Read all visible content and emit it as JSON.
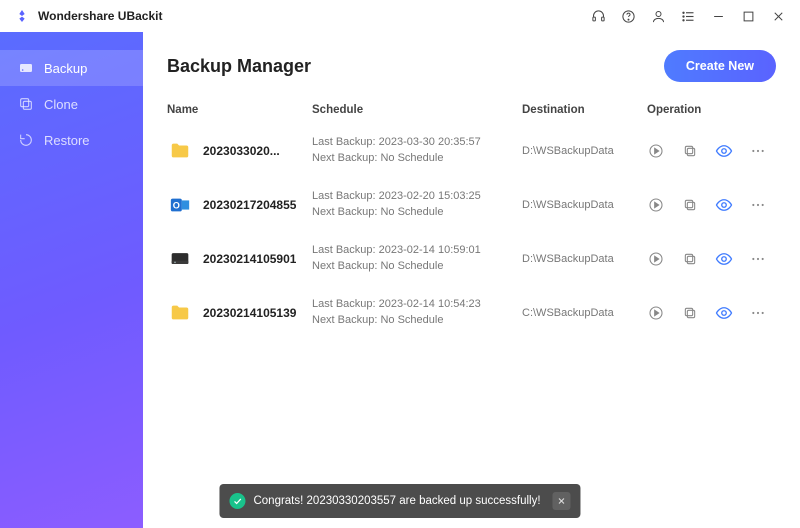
{
  "app_title": "Wondershare UBackit",
  "titlebar_icons": [
    "headset",
    "help",
    "user",
    "list",
    "minimize",
    "maximize",
    "close"
  ],
  "sidebar": {
    "items": [
      {
        "label": "Backup",
        "icon": "disk-icon",
        "active": true
      },
      {
        "label": "Clone",
        "icon": "copy-icon",
        "active": false
      },
      {
        "label": "Restore",
        "icon": "restore-icon",
        "active": false
      }
    ]
  },
  "header": {
    "title": "Backup Manager",
    "create_label": "Create New"
  },
  "columns": {
    "name": "Name",
    "schedule": "Schedule",
    "destination": "Destination",
    "operation": "Operation"
  },
  "rows": [
    {
      "icon": "folder",
      "name": "2023033020...",
      "last": "Last Backup: 2023-03-30 20:35:57",
      "next": "Next Backup: No Schedule",
      "dest": "D:\\WSBackupData"
    },
    {
      "icon": "outlook",
      "name": "20230217204855",
      "last": "Last Backup: 2023-02-20 15:03:25",
      "next": "Next Backup: No Schedule",
      "dest": "D:\\WSBackupData"
    },
    {
      "icon": "disk",
      "name": "20230214105901",
      "last": "Last Backup: 2023-02-14 10:59:01",
      "next": "Next Backup: No Schedule",
      "dest": "D:\\WSBackupData"
    },
    {
      "icon": "folder",
      "name": "20230214105139",
      "last": "Last Backup: 2023-02-14 10:54:23",
      "next": "Next Backup: No Schedule",
      "dest": "C:\\WSBackupData"
    }
  ],
  "toast": {
    "text": "Congrats! 20230330203557 are backed up successfully!"
  }
}
